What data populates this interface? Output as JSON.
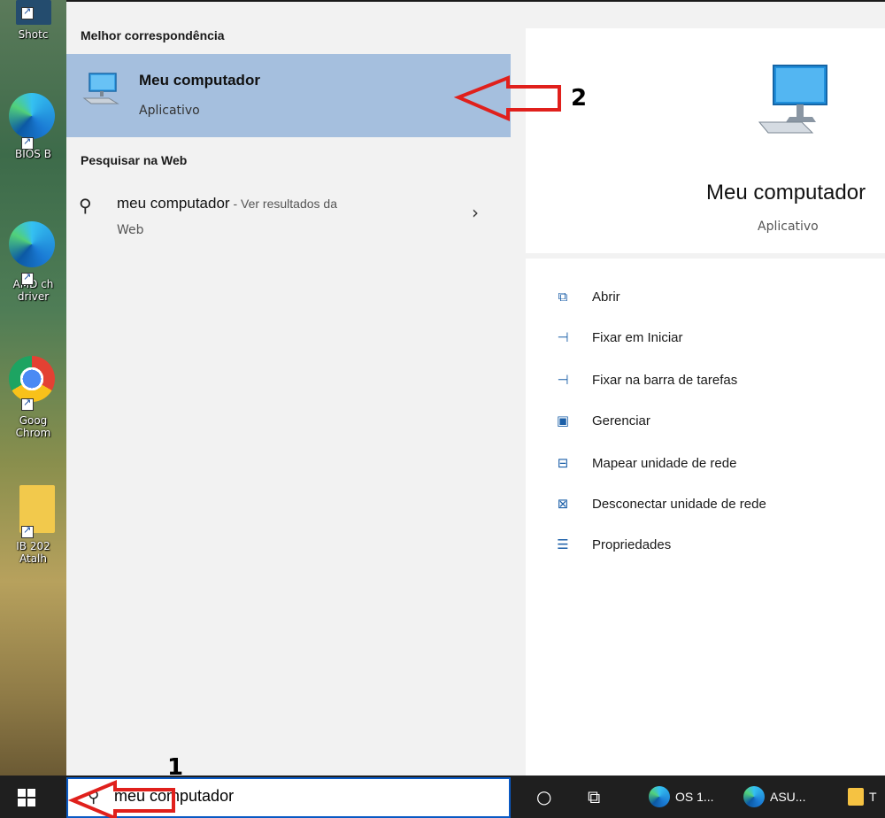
{
  "desktop": {
    "icons": [
      {
        "label": "Shotc",
        "color": "#2a5f8f"
      },
      {
        "label": "BIOS B",
        "color": "#1e86d6"
      },
      {
        "label": "AMD ch",
        "label2": "driver",
        "color": "#1e86d6"
      },
      {
        "label": "Goog",
        "label2": "Chrom",
        "color": "#e34133"
      },
      {
        "label": "IB 202",
        "label2": "Atalh",
        "color": "#f2c94c"
      }
    ]
  },
  "search_panel": {
    "best_match_heading": "Melhor correspondência",
    "best_match": {
      "name": "Meu computador",
      "type": "Aplicativo"
    },
    "web_heading": "Pesquisar na Web",
    "web_result": {
      "query": "meu computador",
      "suffix": " - Ver resultados da",
      "suffix2": "Web"
    }
  },
  "detail_panel": {
    "name": "Meu computador",
    "type": "Aplicativo",
    "actions": [
      {
        "label": "Abrir",
        "icon": "open-icon"
      },
      {
        "label": "Fixar em Iniciar",
        "icon": "pin-icon"
      },
      {
        "label": "Fixar na barra de tarefas",
        "icon": "pin-taskbar-icon"
      },
      {
        "label": "Gerenciar",
        "icon": "manage-icon"
      },
      {
        "label": "Mapear unidade de rede",
        "icon": "map-drive-icon"
      },
      {
        "label": "Desconectar unidade de rede",
        "icon": "disconnect-drive-icon"
      },
      {
        "label": "Propriedades",
        "icon": "properties-icon"
      }
    ]
  },
  "taskbar": {
    "search_value": "meu computador",
    "apps": [
      {
        "label": "OS 1..."
      },
      {
        "label": "ASU..."
      },
      {
        "label": "T"
      }
    ]
  },
  "annotations": {
    "step1": "1",
    "step2": "2",
    "arrow_color": "#e0201c"
  }
}
